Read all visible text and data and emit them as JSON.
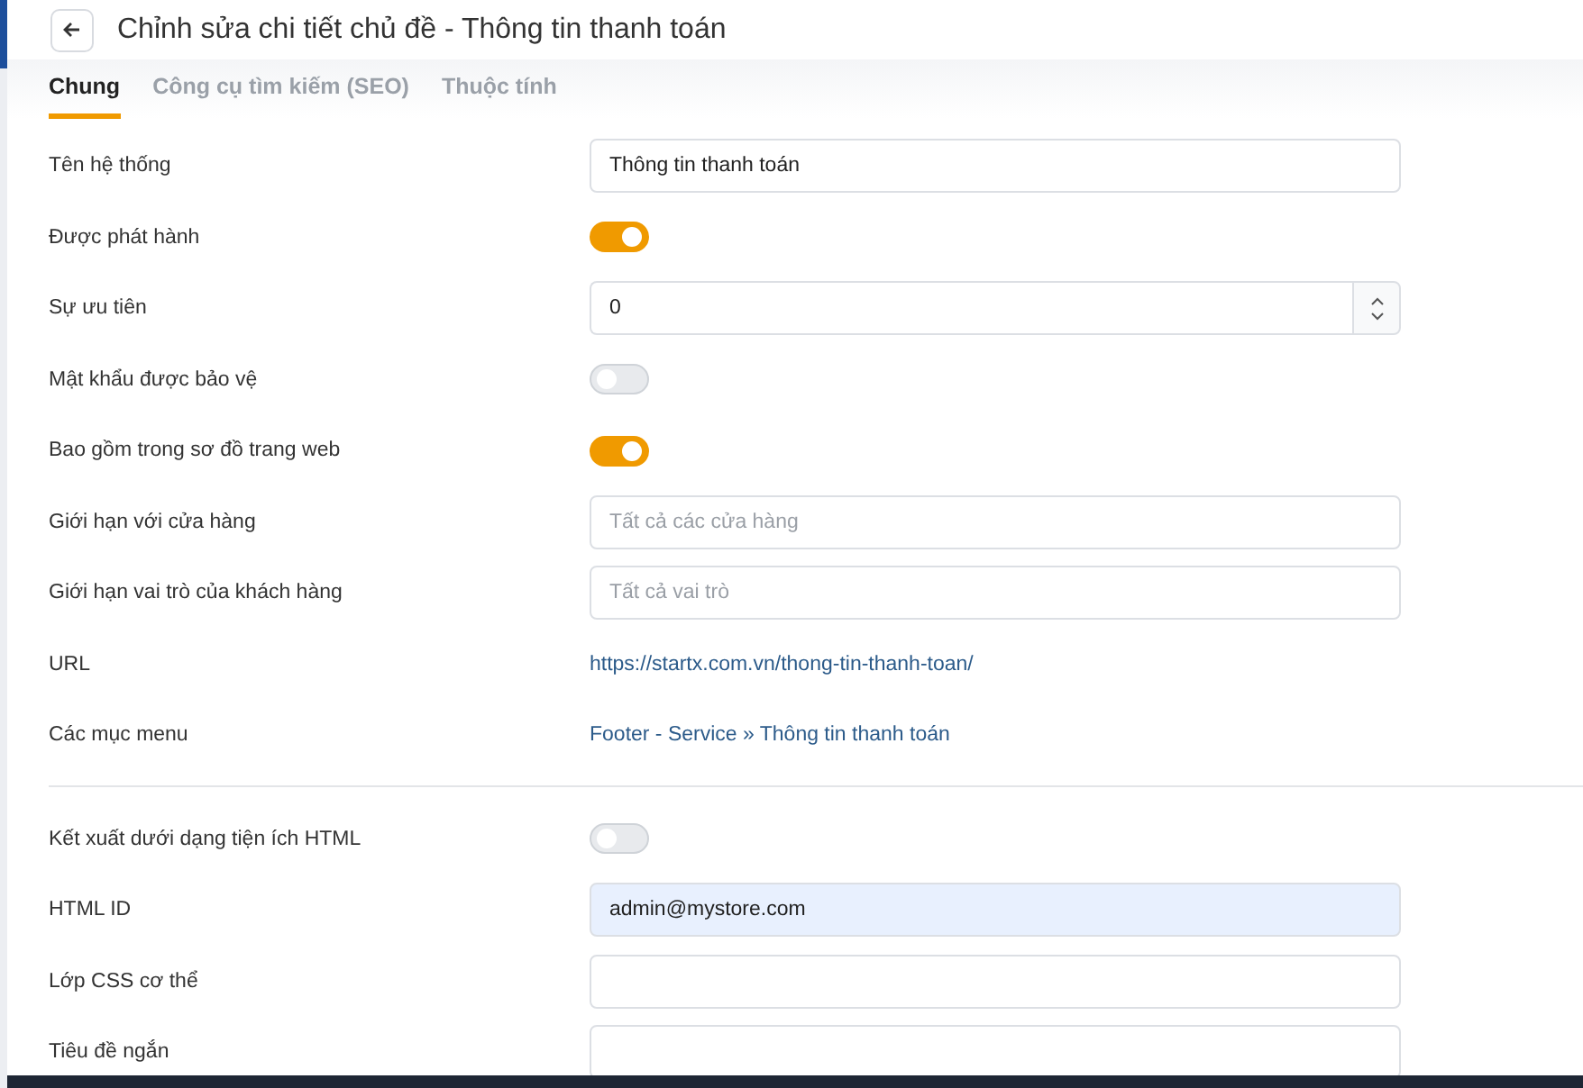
{
  "header": {
    "title": "Chỉnh sửa chi tiết chủ đề - Thông tin thanh toán"
  },
  "tabs": [
    {
      "label": "Chung",
      "selected": true
    },
    {
      "label": "Công cụ tìm kiếm (SEO)",
      "selected": false
    },
    {
      "label": "Thuộc tính",
      "selected": false
    }
  ],
  "sections": [
    [
      {
        "kind": "text",
        "label": "Tên hệ thống",
        "value": "Thông tin thanh toán"
      },
      {
        "kind": "toggle",
        "label": "Được phát hành",
        "on": true
      },
      {
        "kind": "number",
        "label": "Sự ưu tiên",
        "value": "0"
      },
      {
        "kind": "toggle",
        "label": "Mật khẩu được bảo vệ",
        "on": false
      },
      {
        "kind": "toggle",
        "label": "Bao gồm trong sơ đồ trang web",
        "on": true
      },
      {
        "kind": "select",
        "label": "Giới hạn với cửa hàng",
        "placeholder": "Tất cả các cửa hàng"
      },
      {
        "kind": "select",
        "label": "Giới hạn vai trò của khách hàng",
        "placeholder": "Tất cả vai trò"
      },
      {
        "kind": "link",
        "label": "URL",
        "value": "https://startx.com.vn/thong-tin-thanh-toan/"
      },
      {
        "kind": "link",
        "label": "Các mục menu",
        "value": "Footer - Service » Thông tin thanh toán"
      }
    ],
    [
      {
        "kind": "toggle",
        "label": "Kết xuất dưới dạng tiện ích HTML",
        "on": false
      },
      {
        "kind": "filled",
        "label": "HTML ID",
        "value": "admin@mystore.com"
      },
      {
        "kind": "text",
        "label": "Lớp CSS cơ thể"
      },
      {
        "kind": "text",
        "label": "Tiêu đề ngắn"
      }
    ]
  ]
}
